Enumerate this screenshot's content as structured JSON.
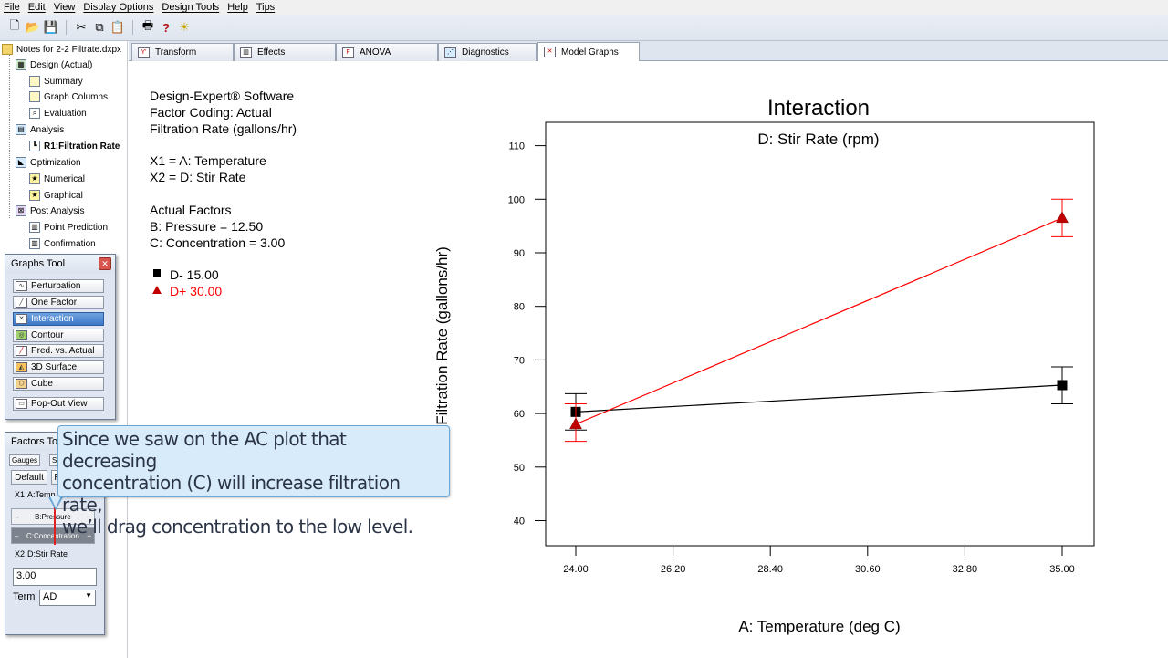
{
  "menu": [
    "File",
    "Edit",
    "View",
    "Display Options",
    "Design Tools",
    "Help",
    "Tips"
  ],
  "toolbar_icons": [
    "new-icon",
    "open-icon",
    "save-icon",
    "cut-icon",
    "copy-icon",
    "paste-icon",
    "print-icon",
    "help-icon",
    "tip-icon"
  ],
  "tree": {
    "root": "Notes for 2-2 Filtrate.dxpx",
    "items": [
      {
        "label": "Design (Actual)"
      },
      {
        "label": "Summary"
      },
      {
        "label": "Graph Columns"
      },
      {
        "label": "Evaluation"
      },
      {
        "label": "Analysis"
      },
      {
        "label": "R1:Filtration Rate"
      },
      {
        "label": "Optimization"
      },
      {
        "label": "Numerical"
      },
      {
        "label": "Graphical"
      },
      {
        "label": "Post Analysis"
      },
      {
        "label": "Point Prediction"
      },
      {
        "label": "Confirmation"
      }
    ]
  },
  "graphs_tool": {
    "title": "Graphs Tool",
    "buttons": [
      "Perturbation",
      "One Factor",
      "Interaction",
      "Contour",
      "Pred. vs. Actual",
      "3D Surface",
      "Cube",
      "Pop-Out View"
    ],
    "active": "Interaction"
  },
  "factors_tool": {
    "title": "Factors Too",
    "tab_gauges": "Gauges",
    "tab_s": "S",
    "default_label": "Default",
    "r_label": "R",
    "x1_label": "X1",
    "x1_factor": "A:Temp",
    "pressure_minus": "–",
    "pressure_label": "B:Pressure",
    "pressure_plus": "+",
    "conc_minus": "–",
    "conc_label": "C:Concentration",
    "conc_plus": "+",
    "x2_label": "X2",
    "x2_factor": "D:Stir Rate",
    "value": "3.00",
    "term_label": "Term",
    "term_value": "AD"
  },
  "tabs": [
    {
      "label": "Transform",
      "icon": "transform-icon"
    },
    {
      "label": "Effects",
      "icon": "effects-icon"
    },
    {
      "label": "ANOVA",
      "icon": "anova-icon"
    },
    {
      "label": "Diagnostics",
      "icon": "diagnostics-icon"
    },
    {
      "label": "Model Graphs",
      "icon": "model-graphs-icon"
    }
  ],
  "info": {
    "software": "Design-Expert® Software",
    "coding": "Factor Coding: Actual",
    "response": "Filtration Rate (gallons/hr)",
    "x1": "X1 = A: Temperature",
    "x2": "X2 = D: Stir Rate",
    "actual_factors": "Actual Factors",
    "pressure": "B: Pressure = 12.50",
    "concentration": "C: Concentration = 3.00",
    "legend_low": "D- 15.00",
    "legend_high": "D+ 30.00"
  },
  "callout": {
    "line1": "Since we saw on the AC plot that decreasing",
    "line2": "concentration (C) will increase filtration rate,",
    "line3": "we’ll drag concentration to the low level."
  },
  "chart_data": {
    "type": "line",
    "title": "Interaction",
    "subtitle": "D: Stir Rate (rpm)",
    "xlabel": "A: Temperature (deg C)",
    "ylabel": "Filtration Rate (gallons/hr)",
    "xlim": [
      24.0,
      35.0
    ],
    "ylim": [
      35,
      112
    ],
    "x_ticks": [
      "24.00",
      "26.20",
      "28.40",
      "30.60",
      "32.80",
      "35.00"
    ],
    "y_ticks": [
      40,
      50,
      60,
      70,
      80,
      90,
      100,
      110
    ],
    "colors": {
      "low": "#000000",
      "high": "#ff0000"
    },
    "series": [
      {
        "name": "D- 15.00",
        "x": [
          24.0,
          35.0
        ],
        "y": [
          60.3,
          65.3
        ],
        "err_low": [
          56.9,
          61.8
        ],
        "err_high": [
          63.7,
          68.7
        ],
        "marker": "square"
      },
      {
        "name": "D+ 30.00",
        "x": [
          24.0,
          35.0
        ],
        "y": [
          58.0,
          96.5
        ],
        "err_low": [
          54.8,
          93.0
        ],
        "err_high": [
          61.8,
          100.0
        ],
        "marker": "triangle"
      }
    ]
  }
}
